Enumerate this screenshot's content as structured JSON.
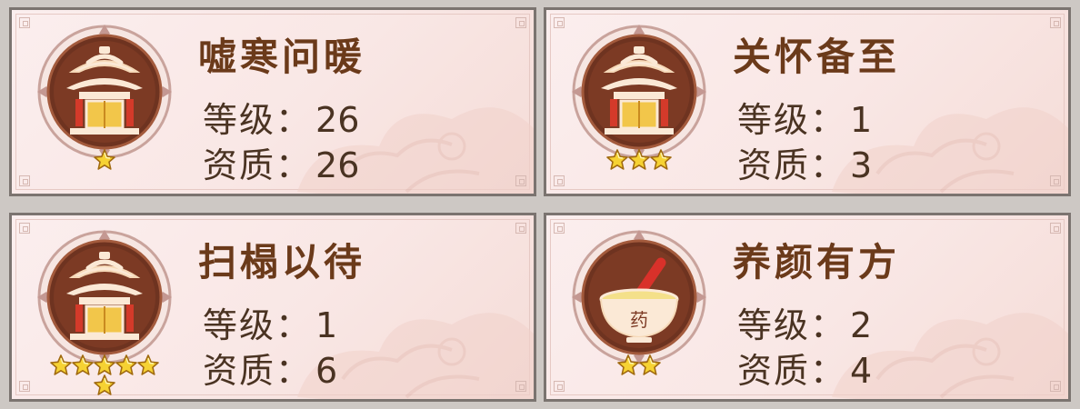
{
  "cards": [
    {
      "title": "嘘寒问暖",
      "icon": "pavilion-icon",
      "stars": 1,
      "level_label": "等级",
      "level_value": "26",
      "quality_label": "资质",
      "quality_value": "26",
      "sep": "："
    },
    {
      "title": "关怀备至",
      "icon": "pavilion-icon",
      "stars": 3,
      "level_label": "等级",
      "level_value": "1",
      "quality_label": "资质",
      "quality_value": "3",
      "sep": "："
    },
    {
      "title": "扫榻以待",
      "icon": "pavilion-icon",
      "stars": 6,
      "level_label": "等级",
      "level_value": "1",
      "quality_label": "资质",
      "quality_value": "6",
      "sep": "："
    },
    {
      "title": "养颜有方",
      "icon": "medicine-bowl-icon",
      "stars": 2,
      "level_label": "等级",
      "level_value": "2",
      "quality_label": "资质",
      "quality_value": "4",
      "sep": "："
    }
  ],
  "icon_text": {
    "medicine": "药"
  },
  "colors": {
    "card_bg": "#f9e7e5",
    "border": "#7b7470",
    "title": "#6b3a1a",
    "badge": "#7a3a22",
    "star": "#f5cf2a"
  }
}
